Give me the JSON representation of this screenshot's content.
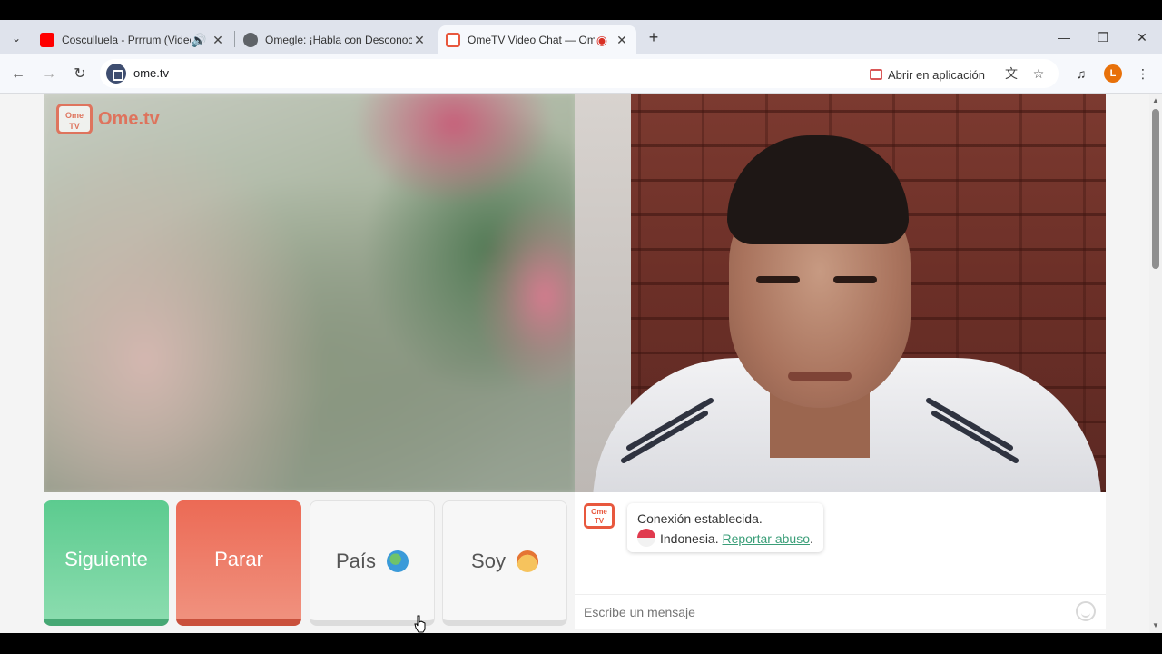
{
  "browser": {
    "tabs": [
      {
        "title": "Cosculluela - Prrrum (Video",
        "favicon_color": "#ff0000",
        "has_audio": true
      },
      {
        "title": "Omegle: ¡Habla con Desconocid",
        "favicon_color": "#5f6368"
      },
      {
        "title": "OmeTV Video Chat — Ome",
        "favicon_color": "#e8583e",
        "recording": true,
        "active": true
      }
    ],
    "new_tab": "+",
    "window_controls": {
      "minimize": "—",
      "restore": "❐",
      "close": "✕"
    },
    "url": "ome.tv",
    "open_in_app": "Abrir en aplicación",
    "profile_initial": "L"
  },
  "page": {
    "logo_badge": "Ome\nTV",
    "logo_text": "Ome.tv",
    "buttons": {
      "next": "Siguiente",
      "stop": "Parar",
      "country": "País",
      "gender": "Soy"
    },
    "chat": {
      "logo_badge": "Ome TV",
      "status": "Conexión establecida.",
      "country": "Indonesia.",
      "report_link": "Reportar abuso",
      "report_suffix": ".",
      "input_placeholder": "Escribe un mensaje"
    }
  },
  "colors": {
    "next": "#5ccb8f",
    "stop": "#ec6a55",
    "brand": "#e8583e",
    "link": "#3a9e78"
  }
}
